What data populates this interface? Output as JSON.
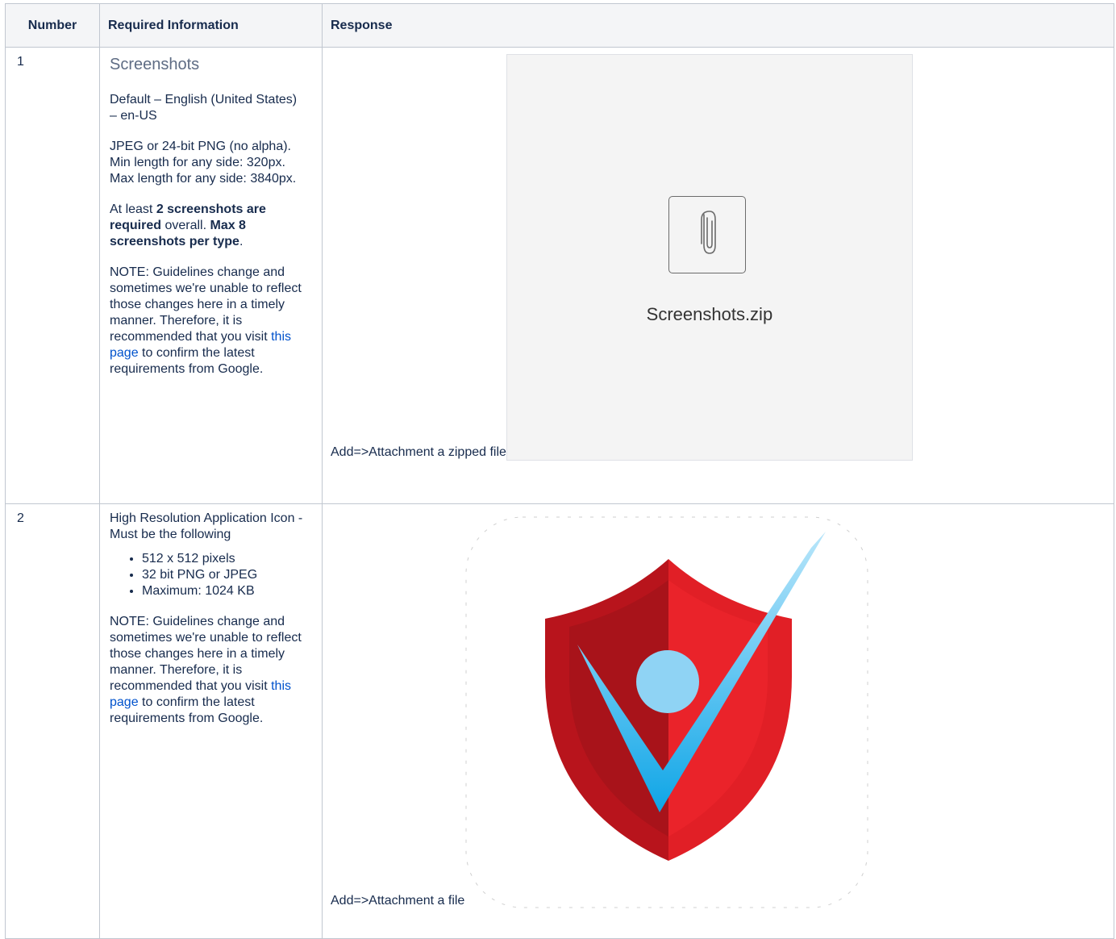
{
  "table": {
    "headers": {
      "number": "Number",
      "required_info": "Required Information",
      "response": "Response"
    }
  },
  "rows": [
    {
      "number": "1",
      "title": "Screenshots",
      "default_locale": "Default – English (United States) – en-US",
      "format": "JPEG or 24-bit PNG (no alpha). Min length for any side: 320px. Max length for any side: 3840px.",
      "req_prefix": "At least ",
      "req_bold1": "2 screenshots are required",
      "req_mid": " overall. ",
      "req_bold2": "Max 8 screenshots per type",
      "req_suffix": ".",
      "note_before": "NOTE:  Guidelines change and sometimes we're unable to reflect those changes here in a timely manner.  Therefore, it is recommended that you visit ",
      "note_link": "this page",
      "note_after": " to confirm the latest requirements from Google.",
      "response_text": "Add=>Attachment a zipped file",
      "attachment_name": "Screenshots.zip",
      "attachment_icon": "paperclip-icon"
    },
    {
      "number": "2",
      "intro": "High Resolution Application Icon - Must be the following",
      "bullets": [
        "512 x 512 pixels",
        "32 bit PNG or JPEG",
        "Maximum: 1024 KB"
      ],
      "note_before": "NOTE:  Guidelines change and sometimes we're unable to reflect those changes here in a timely manner.  Therefore, it is recommended that you visit ",
      "note_link": "this page",
      "note_after": " to confirm the latest requirements from Google.",
      "response_text": "Add=>Attachment a file",
      "app_icon": "shield-check-logo"
    }
  ],
  "colors": {
    "link": "#0052cc",
    "header_bg": "#f4f5f7",
    "border": "#c1c7d0",
    "shield_red": "#e11f26",
    "shield_dark_red": "#9b1219",
    "check_blue": "#1aa9e8",
    "dot_blue": "#8fd3f4"
  }
}
